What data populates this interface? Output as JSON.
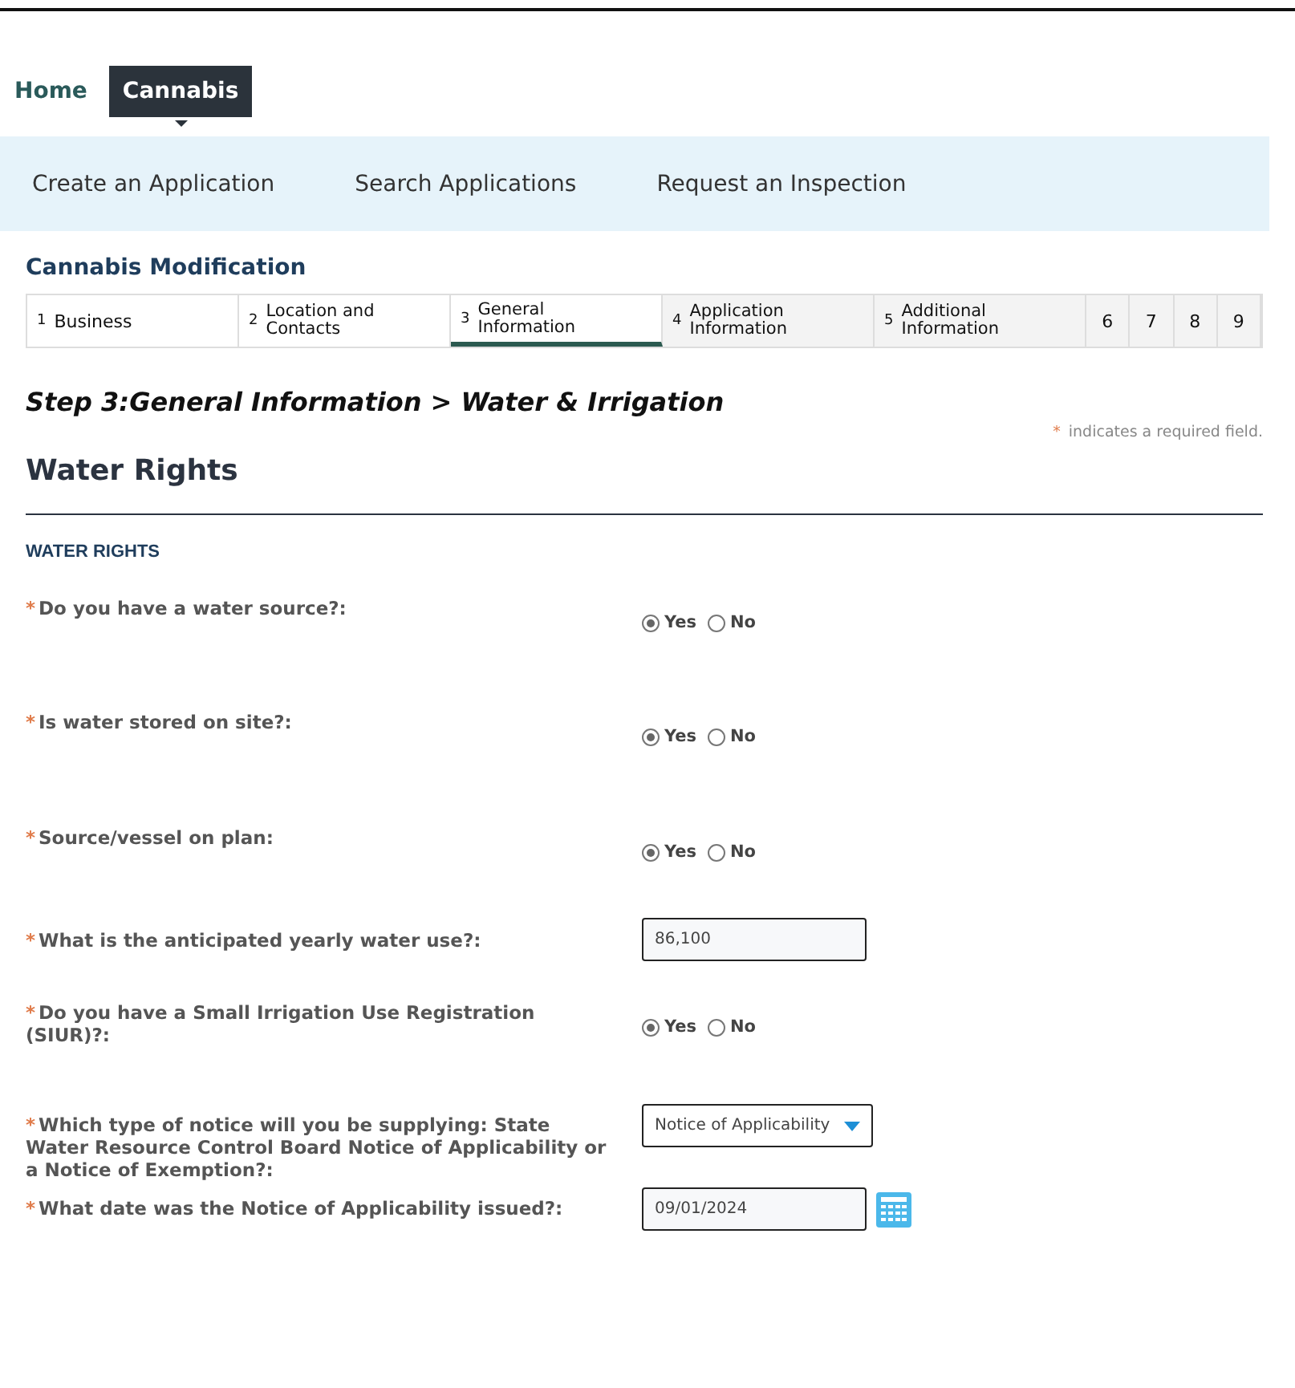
{
  "nav": {
    "items": [
      {
        "label": "Home",
        "selected": false
      },
      {
        "label": "Cannabis",
        "selected": true
      }
    ]
  },
  "menu": [
    "Create an Application",
    "Search Applications",
    "Request an Inspection"
  ],
  "record_type": "Cannabis Modification",
  "steps": [
    {
      "number": "1",
      "label": "Business",
      "selected": false,
      "visited": true
    },
    {
      "number": "2",
      "label": "Location and Contacts",
      "selected": false,
      "visited": true
    },
    {
      "number": "3",
      "label": "General Information",
      "selected": true,
      "visited": true
    },
    {
      "number": "4",
      "label": "Application Information",
      "selected": false,
      "visited": false
    },
    {
      "number": "5",
      "label": "Additional Information",
      "selected": false,
      "visited": false
    },
    {
      "number": "6",
      "selected": false,
      "visited": false
    },
    {
      "number": "7",
      "selected": false,
      "visited": false
    },
    {
      "number": "8",
      "selected": false,
      "visited": false
    },
    {
      "number": "9",
      "selected": false,
      "visited": false
    }
  ],
  "step_heading": {
    "step": "Step 3:",
    "page": "General Information",
    "separator": ">",
    "section": "Water & Irrigation"
  },
  "required_note": {
    "mark": "*",
    "text": "indicates a required field."
  },
  "section_title": "Water Rights",
  "subsection_title": "WATER RIGHTS",
  "questions": [
    {
      "kind": "radio",
      "required": true,
      "label": "Do you have a water source?:",
      "options": [
        {
          "label": "Yes",
          "selected": true
        },
        {
          "label": "No",
          "selected": false
        }
      ]
    },
    {
      "kind": "radio",
      "required": true,
      "label": "Is water stored on site?:",
      "options": [
        {
          "label": "Yes",
          "selected": true
        },
        {
          "label": "No",
          "selected": false
        }
      ]
    },
    {
      "kind": "radio",
      "required": true,
      "label": "Source/vessel on plan:",
      "options": [
        {
          "label": "Yes",
          "selected": true
        },
        {
          "label": "No",
          "selected": false
        }
      ]
    },
    {
      "kind": "text",
      "required": true,
      "label": "What is the anticipated yearly water use?:",
      "value": "86,100"
    },
    {
      "kind": "radio",
      "required": true,
      "label": "Do you have a Small Irrigation Use Registration (SIUR)?:",
      "options": [
        {
          "label": "Yes",
          "selected": true
        },
        {
          "label": "No",
          "selected": false
        }
      ]
    },
    {
      "kind": "select",
      "required": true,
      "label": "Which type of notice will you be supplying: State Water Resource Control Board Notice of Applicability or a Notice of Exemption?:",
      "value": "Notice of Applicability"
    },
    {
      "kind": "date",
      "required": true,
      "label": "What date was the Notice of Applicability issued?:",
      "value": "09/01/2024"
    }
  ]
}
